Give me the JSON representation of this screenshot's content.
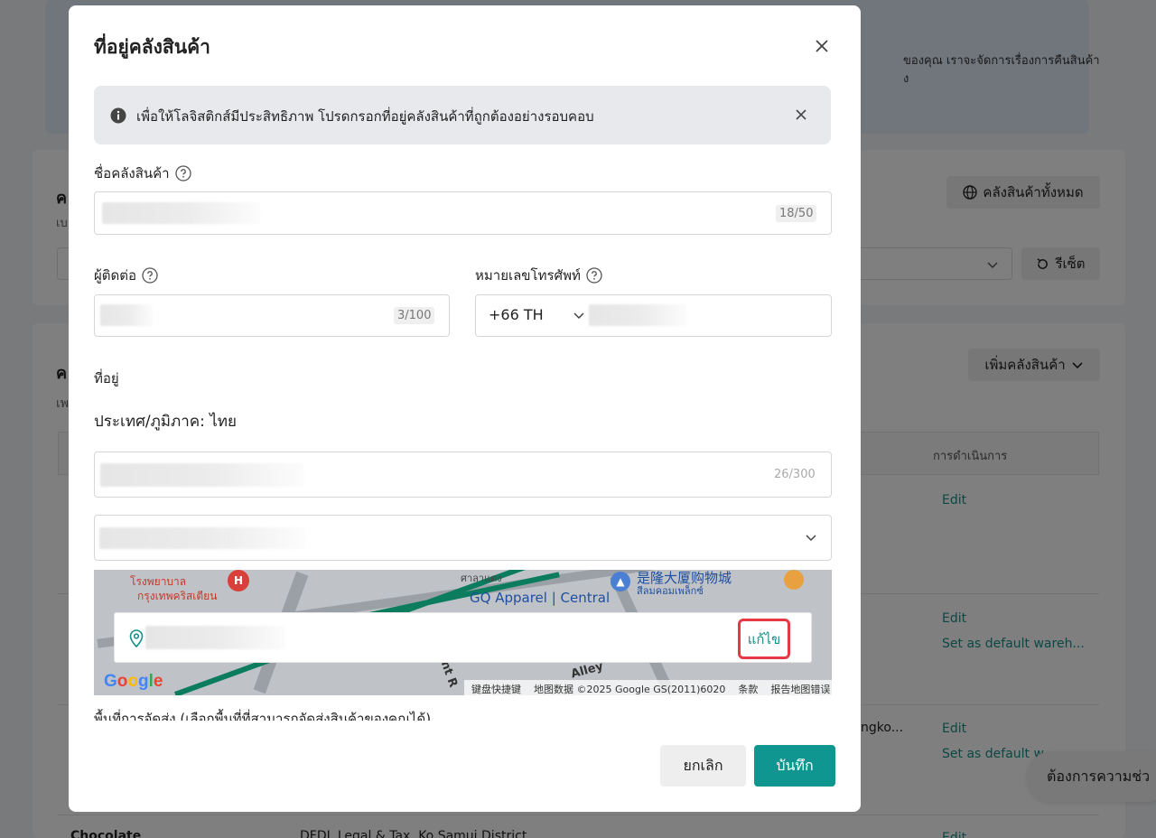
{
  "background": {
    "banner_text": [
      "ของคุณ เราจะจัดการเรื่องการคืนสินค้า",
      "ง"
    ],
    "all_warehouses_button": "คลังสินค้าทั้งหมด",
    "reset_button": "รีเซ็ต",
    "add_warehouse_button": "เพิ่มคลังสินค้า",
    "actions_header": "การดำเนินการ",
    "left_fragments": [
      "ค",
      "เบ",
      "ค",
      "เพ"
    ],
    "rows": [
      {
        "name": "",
        "address": "",
        "actions": [
          "Edit"
        ]
      },
      {
        "name": "",
        "address": "",
        "actions": [
          "Edit",
          "Set as default wareh..."
        ]
      },
      {
        "name": "",
        "address": "ngko...",
        "actions": [
          "Edit",
          "Set as default w"
        ]
      },
      {
        "name": "Chocolate",
        "address": "DFDL Legal & Tax, Ko Samui District",
        "actions": [
          "Edit"
        ]
      }
    ],
    "help_pill": "ต้องการความช่ว"
  },
  "modal": {
    "title": "ที่อยู่คลังสินค้า",
    "notice": "เพื่อให้โลจิสติกส์มีประสิทธิภาพ โปรดกรอกที่อยู่คลังสินค้าที่ถูกต้องอย่างรอบคอบ",
    "warehouse_name": {
      "label": "ชื่อคลังสินค้า",
      "counter": "18/50"
    },
    "contact": {
      "label": "ผู้ติดต่อ",
      "counter": "3/100"
    },
    "phone": {
      "label": "หมายเลขโทรศัพท์",
      "country_code": "+66 TH"
    },
    "address_label": "ที่อยู่",
    "country": "ประเทศ/ภูมิภาค: ไทย",
    "address_counter": "26/300",
    "map": {
      "labels": [
        "是隆大厦购物城",
        "สีลมคอมเพล็กซ์",
        "GQ Apparel | Central",
        "ศาลาแดง",
        "โรงพยาบาล",
        "กรุงเทพคริสเตียน",
        "ent R",
        "Alley"
      ],
      "footer": [
        "键盘快捷键",
        "地图数据 ©2025 Google GS(2011)6020",
        "条款",
        "报告地图错误"
      ],
      "logo": "Google",
      "edit_label": "แก้ไข"
    },
    "service_area_text": "พื้นที่การจัดส่ง (เลือกพื้นที่ที่สามารถจัดส่งสินค้าของคุณได้)",
    "cancel_button": "ยกเลิก",
    "save_button": "บันทึก"
  },
  "colors": {
    "accent": "#0f9690",
    "link": "#1a8f8a",
    "highlight": "#e53945",
    "notice_bg": "#e8e9ec"
  },
  "icons": [
    "close-icon",
    "info-icon",
    "help-icon",
    "chevron-down-icon",
    "location-pin-icon",
    "globe-icon",
    "reset-icon"
  ]
}
